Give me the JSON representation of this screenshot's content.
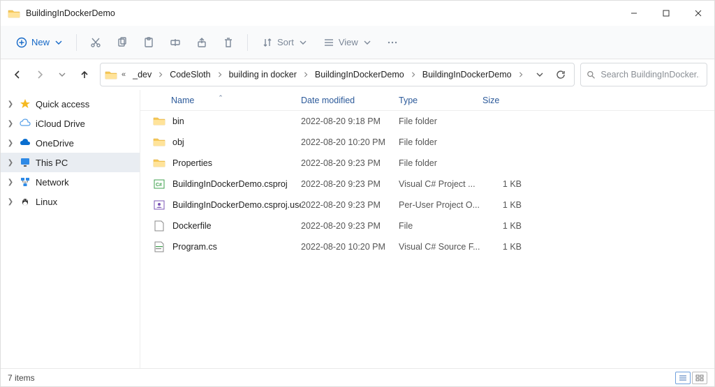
{
  "window": {
    "title": "BuildingInDockerDemo"
  },
  "toolbar": {
    "new_label": "New",
    "sort_label": "Sort",
    "view_label": "View"
  },
  "breadcrumb": {
    "items": [
      "_dev",
      "CodeSloth",
      "building in docker",
      "BuildingInDockerDemo",
      "BuildingInDockerDemo"
    ]
  },
  "search": {
    "placeholder": "Search BuildingInDocker..."
  },
  "nav_pane": {
    "items": [
      {
        "label": "Quick access",
        "icon": "star",
        "selected": false
      },
      {
        "label": "iCloud Drive",
        "icon": "icloud",
        "selected": false
      },
      {
        "label": "OneDrive",
        "icon": "cloud",
        "selected": false
      },
      {
        "label": "This PC",
        "icon": "monitor",
        "selected": true
      },
      {
        "label": "Network",
        "icon": "network",
        "selected": false
      },
      {
        "label": "Linux",
        "icon": "linux",
        "selected": false
      }
    ]
  },
  "columns": {
    "name": "Name",
    "date": "Date modified",
    "type": "Type",
    "size": "Size"
  },
  "files": [
    {
      "name": "bin",
      "date": "2022-08-20 9:18 PM",
      "type": "File folder",
      "size": "",
      "icon": "folder"
    },
    {
      "name": "obj",
      "date": "2022-08-20 10:20 PM",
      "type": "File folder",
      "size": "",
      "icon": "folder"
    },
    {
      "name": "Properties",
      "date": "2022-08-20 9:23 PM",
      "type": "File folder",
      "size": "",
      "icon": "folder"
    },
    {
      "name": "BuildingInDockerDemo.csproj",
      "date": "2022-08-20 9:23 PM",
      "type": "Visual C# Project ...",
      "size": "1 KB",
      "icon": "csproj"
    },
    {
      "name": "BuildingInDockerDemo.csproj.user",
      "date": "2022-08-20 9:23 PM",
      "type": "Per-User Project O...",
      "size": "1 KB",
      "icon": "userproj"
    },
    {
      "name": "Dockerfile",
      "date": "2022-08-20 9:23 PM",
      "type": "File",
      "size": "1 KB",
      "icon": "file"
    },
    {
      "name": "Program.cs",
      "date": "2022-08-20 10:20 PM",
      "type": "Visual C# Source F...",
      "size": "1 KB",
      "icon": "cs"
    }
  ],
  "status": {
    "item_count": "7 items"
  }
}
